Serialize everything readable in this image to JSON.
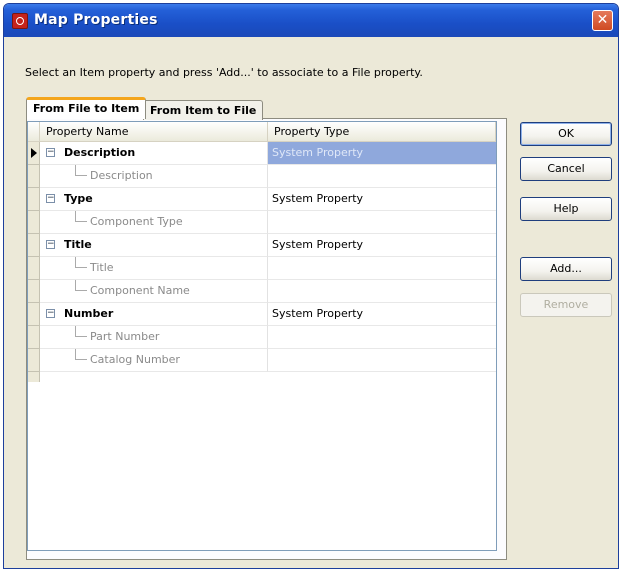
{
  "window": {
    "title": "Map Properties",
    "close_glyph": "✕"
  },
  "instruction": "Select an Item property and press 'Add...' to associate to a File property.",
  "tabs": [
    {
      "label": "From File to Item",
      "active": true
    },
    {
      "label": "From Item to File",
      "active": false
    }
  ],
  "grid": {
    "columns": [
      "Property Name",
      "Property Type"
    ],
    "rows": [
      {
        "name": "Description",
        "type": "System Property",
        "level": "parent"
      },
      {
        "name": "Description",
        "type": "",
        "level": "child"
      },
      {
        "name": "Type",
        "type": "System Property",
        "level": "parent"
      },
      {
        "name": "Component Type",
        "type": "",
        "level": "child"
      },
      {
        "name": "Title",
        "type": "System Property",
        "level": "parent"
      },
      {
        "name": "Title",
        "type": "",
        "level": "child"
      },
      {
        "name": "Component Name",
        "type": "",
        "level": "child"
      },
      {
        "name": "Number",
        "type": "System Property",
        "level": "parent"
      },
      {
        "name": "Part Number",
        "type": "",
        "level": "child"
      },
      {
        "name": "Catalog Number",
        "type": "",
        "level": "child"
      }
    ],
    "selected_row": 0,
    "expander_glyph": "−"
  },
  "buttons": {
    "ok": "OK",
    "cancel": "Cancel",
    "help": "Help",
    "add": "Add...",
    "remove": "Remove"
  },
  "colors": {
    "title_bar": "#1a4fc7",
    "active_tab_accent": "#f4a61d",
    "selection": "#8fa8dc"
  }
}
